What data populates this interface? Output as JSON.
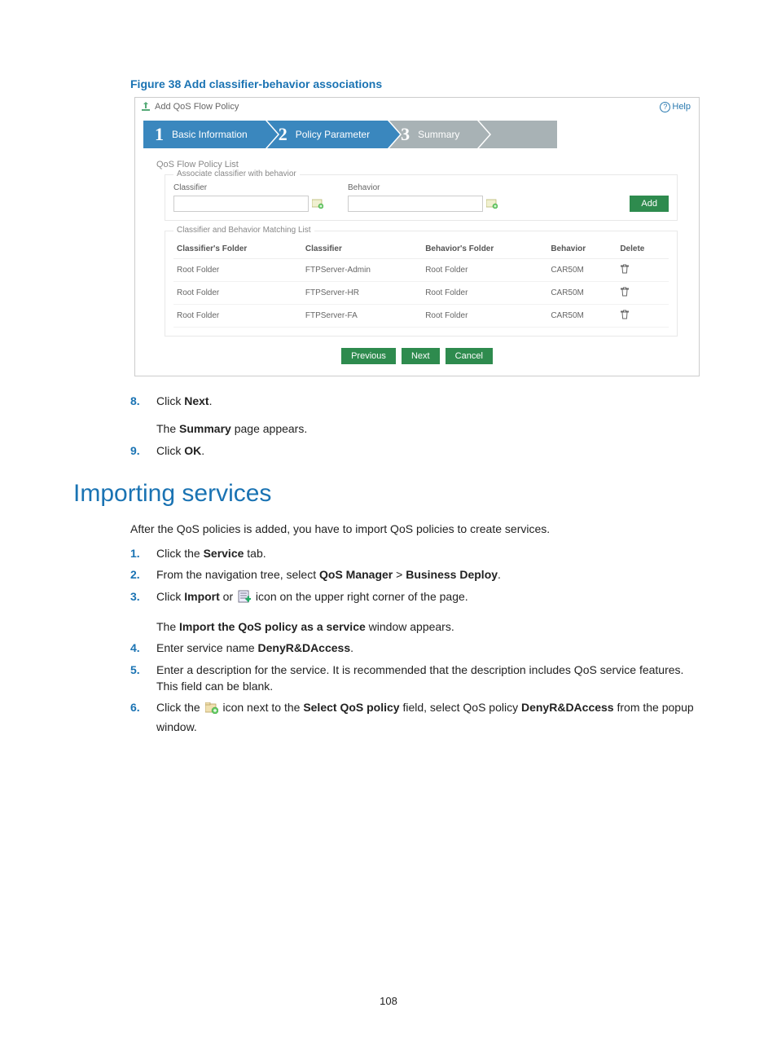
{
  "figure_caption": "Figure 38 Add classifier-behavior associations",
  "screenshot": {
    "title": "Add QoS Flow Policy",
    "help": "Help",
    "steps": {
      "s1": {
        "num": "1",
        "label": "Basic Information"
      },
      "s2": {
        "num": "2",
        "label": "Policy Parameter"
      },
      "s3": {
        "num": "3",
        "label": "Summary"
      }
    },
    "qos_list_title": "QoS Flow Policy List",
    "assoc": {
      "legend": "Associate classifier with behavior",
      "classifier_label": "Classifier",
      "behavior_label": "Behavior",
      "add_label": "Add"
    },
    "match": {
      "legend": "Classifier and Behavior Matching List",
      "th_cf": "Classifier's Folder",
      "th_c": "Classifier",
      "th_bf": "Behavior's Folder",
      "th_b": "Behavior",
      "th_del": "Delete",
      "rows": [
        {
          "cf": "Root Folder",
          "c": "FTPServer-Admin",
          "bf": "Root Folder",
          "b": "CAR50M"
        },
        {
          "cf": "Root Folder",
          "c": "FTPServer-HR",
          "bf": "Root Folder",
          "b": "CAR50M"
        },
        {
          "cf": "Root Folder",
          "c": "FTPServer-FA",
          "bf": "Root Folder",
          "b": "CAR50M"
        }
      ]
    },
    "buttons": {
      "prev": "Previous",
      "next": "Next",
      "cancel": "Cancel"
    }
  },
  "steps_a": {
    "s8": {
      "num": "8.",
      "prefix": "Click ",
      "bold": "Next",
      "suffix": "."
    },
    "s8_sub_a": "The ",
    "s8_sub_b": "Summary",
    "s8_sub_c": " page appears.",
    "s9": {
      "num": "9.",
      "prefix": "Click ",
      "bold": "OK",
      "suffix": "."
    }
  },
  "heading": "Importing services",
  "intro": "After the QoS policies is added, you have to import QoS policies to create services.",
  "steps_b": {
    "s1": {
      "num": "1.",
      "a": "Click the ",
      "b": "Service",
      "c": " tab."
    },
    "s2": {
      "num": "2.",
      "a": "From the navigation tree, select ",
      "b1": "QoS Manager",
      "gt": " > ",
      "b2": "Business Deploy",
      "c": "."
    },
    "s3": {
      "num": "3.",
      "a": "Click ",
      "b": "Import",
      "c": " or ",
      "d": " icon on the upper right corner of the page."
    },
    "s3_sub_a": "The ",
    "s3_sub_b": "Import the QoS policy as a service",
    "s3_sub_c": " window appears.",
    "s4": {
      "num": "4.",
      "a": "Enter service name ",
      "b": "DenyR&DAccess",
      "c": "."
    },
    "s5": {
      "num": "5.",
      "a": "Enter a description for the service. It is recommended that the description includes QoS service features. This field can be blank."
    },
    "s6": {
      "num": "6.",
      "a": "Click the ",
      "b": " icon next to the ",
      "c": "Select QoS policy",
      "d": " field, select QoS policy ",
      "e": "DenyR&DAccess",
      "f": " from the popup window."
    }
  },
  "page_number": "108"
}
